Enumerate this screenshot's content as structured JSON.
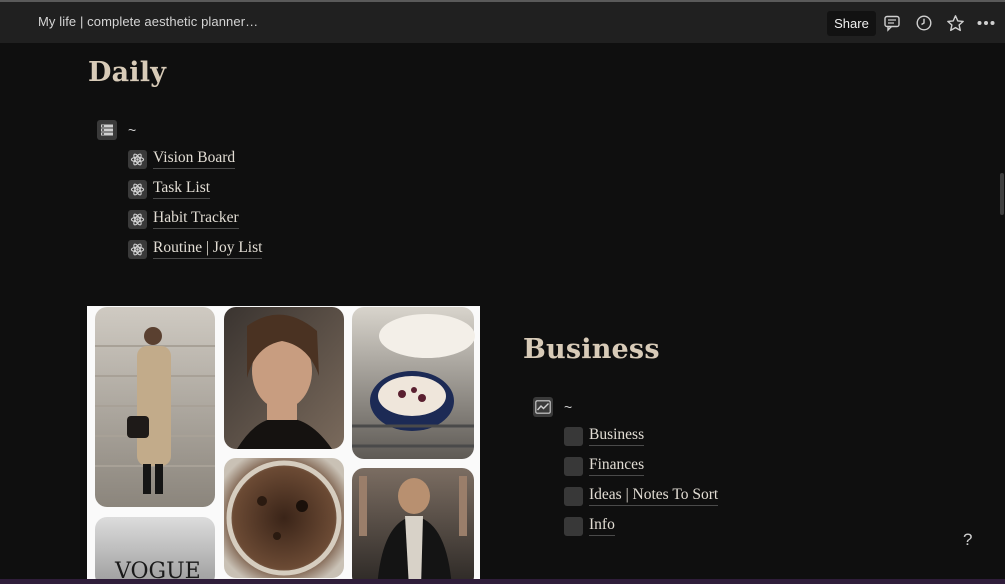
{
  "topbar": {
    "breadcrumb": "My life | complete aesthetic planner…",
    "share_label": "Share",
    "icons": [
      "comment-icon",
      "clock-icon",
      "star-icon",
      "more-icon"
    ]
  },
  "daily": {
    "title": "Daily",
    "db_label": "~",
    "items": [
      "Vision Board",
      "Task List",
      "Habit Tracker",
      "Routine | Joy List"
    ]
  },
  "business": {
    "title": "Business",
    "db_label": "~",
    "items": [
      "Business",
      "Finances",
      "Ideas | Notes To Sort",
      "Info"
    ]
  },
  "help_label": "?",
  "colors": {
    "topbar": "#202020",
    "background": "#0f0f0f",
    "heading": "#d8cbb8",
    "text": "#e2ddd4"
  }
}
